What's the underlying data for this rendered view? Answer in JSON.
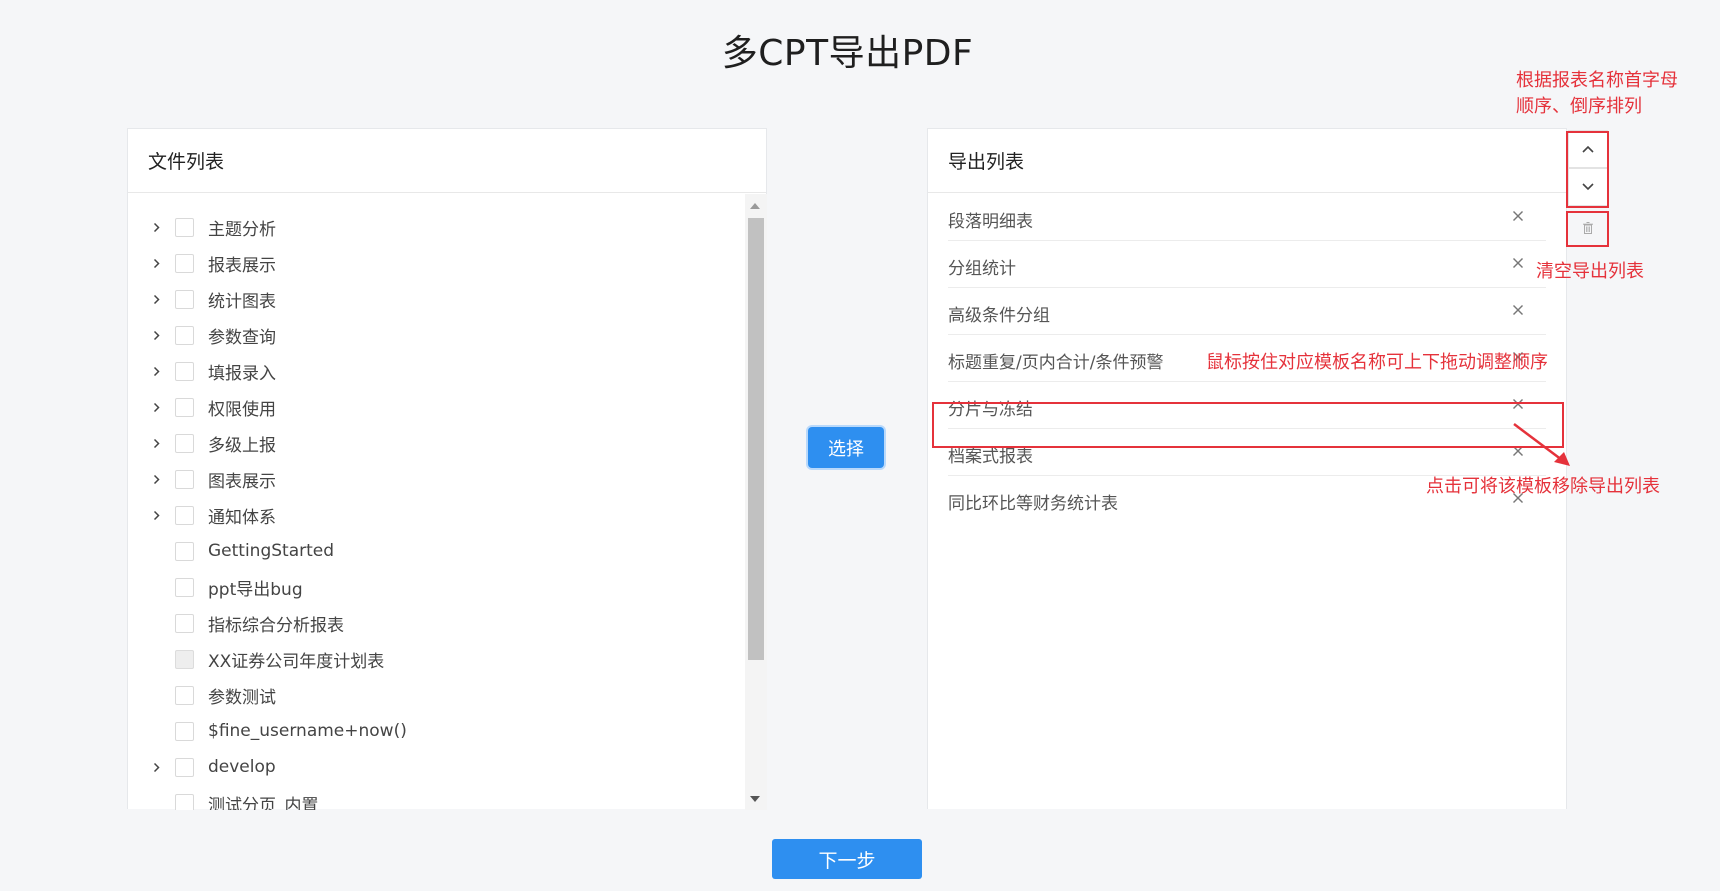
{
  "page_title": "多CPT导出PDF",
  "left_panel": {
    "header": "文件列表",
    "items": [
      {
        "label": "主题分析",
        "expandable": true,
        "disabled": false
      },
      {
        "label": "报表展示",
        "expandable": true,
        "disabled": false
      },
      {
        "label": "统计图表",
        "expandable": true,
        "disabled": false
      },
      {
        "label": "参数查询",
        "expandable": true,
        "disabled": false
      },
      {
        "label": "填报录入",
        "expandable": true,
        "disabled": false
      },
      {
        "label": "权限使用",
        "expandable": true,
        "disabled": false
      },
      {
        "label": "多级上报",
        "expandable": true,
        "disabled": false
      },
      {
        "label": "图表展示",
        "expandable": true,
        "disabled": false
      },
      {
        "label": "通知体系",
        "expandable": true,
        "disabled": false
      },
      {
        "label": "GettingStarted",
        "expandable": false,
        "disabled": false
      },
      {
        "label": "ppt导出bug",
        "expandable": false,
        "disabled": false
      },
      {
        "label": "指标综合分析报表",
        "expandable": false,
        "disabled": false
      },
      {
        "label": "XX证券公司年度计划表",
        "expandable": false,
        "disabled": true
      },
      {
        "label": "参数测试",
        "expandable": false,
        "disabled": false
      },
      {
        "label": "$fine_username+now()",
        "expandable": false,
        "disabled": false
      },
      {
        "label": "develop",
        "expandable": true,
        "disabled": false
      },
      {
        "label": "测试分页_内置",
        "expandable": false,
        "disabled": false
      }
    ]
  },
  "select_button": "选择",
  "right_panel": {
    "header": "导出列表",
    "items": [
      "段落明细表",
      "分组统计",
      "高级条件分组",
      "标题重复/页内合计/条件预警",
      "分片与冻结",
      "档案式报表",
      "同比环比等财务统计表"
    ]
  },
  "side_controls": {
    "sort_asc_icon": "chevron-up-icon",
    "sort_desc_icon": "chevron-down-icon",
    "clear_icon": "trash-icon"
  },
  "annotations": {
    "sort_note_line1": "根据报表名称首字母",
    "sort_note_line2": "顺序、倒序排列",
    "clear_note": "清空导出列表",
    "drag_note": "鼠标按住对应模板名称可上下拖动调整顺序",
    "remove_note": "点击可将该模板移除导出列表",
    "color": "#e5323b"
  },
  "next_button": "下一步",
  "colors": {
    "primary": "#2e8ff0",
    "background": "#f5f6f8"
  }
}
